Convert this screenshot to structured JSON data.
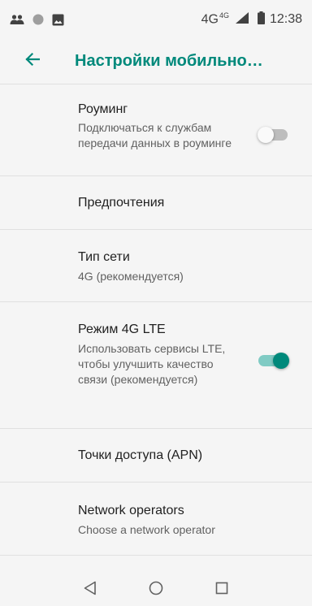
{
  "status_bar": {
    "network": "4G",
    "network_sup": "4G",
    "time": "12:38",
    "icons": [
      "people-icon",
      "circle-icon",
      "image-icon",
      "signal-icon",
      "battery-icon"
    ]
  },
  "header": {
    "title": "Настройки мобильно…",
    "back_icon": "arrow-back-icon"
  },
  "settings": {
    "roaming": {
      "title": "Роуминг",
      "subtitle": "Подключаться к службам передачи данных в роуминге",
      "enabled": false
    },
    "preferences": {
      "title": "Предпочтения"
    },
    "network_type": {
      "title": "Тип сети",
      "subtitle": "4G (рекомендуется)"
    },
    "lte_mode": {
      "title": "Режим 4G LTE",
      "subtitle": "Использовать сервисы LTE, чтобы улучшить качество связи (рекомендуется)",
      "enabled": true
    },
    "apn": {
      "title": "Точки доступа (APN)"
    },
    "network_operators": {
      "title": "Network operators",
      "subtitle": "Choose a network operator"
    }
  },
  "nav_bar": {
    "icons": [
      "back-triangle-icon",
      "home-circle-icon",
      "recents-square-icon"
    ]
  },
  "colors": {
    "accent": "#00897b",
    "accent_light": "#80cbc4",
    "background": "#f5f5f5",
    "divider": "#e0e0e0"
  }
}
